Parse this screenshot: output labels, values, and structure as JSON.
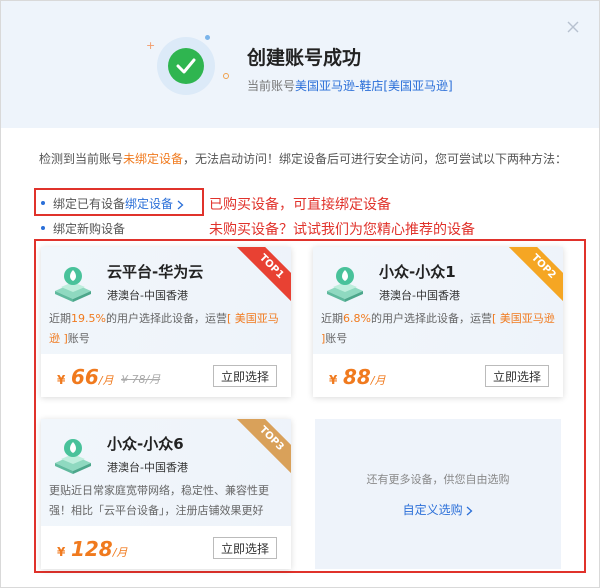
{
  "header": {
    "title": "创建账号成功",
    "subtitle_prefix": "当前账号",
    "account": "美国亚马逊-鞋店[美国亚马逊]",
    "close_icon": "close-icon",
    "success_icon": "check-circle-icon"
  },
  "description": {
    "part1": "检测到当前账号",
    "warn": "未绑定设备",
    "part2": "，无法启动访问！绑定设备后可进行安全访问，您可尝试以下两种方法："
  },
  "options": [
    {
      "text": "绑定已有设备",
      "link": "绑定设备",
      "chevron": "chevron-right-icon"
    },
    {
      "text": "绑定新购设备"
    }
  ],
  "annotations": {
    "bought": "已购买设备，可直接绑定设备",
    "not_bought": "未购买设备？试试我们为您精心推荐的设备"
  },
  "products": [
    {
      "name": "云平台-华为云",
      "region": "港澳台-中国香港",
      "desc_prefix": "近期",
      "percent": "19.5%",
      "desc_mid": "的用户选择此设备，运营",
      "account_hl": "[ 美国亚马逊 ]",
      "desc_suffix": "账号",
      "currency": "¥",
      "price": "66",
      "unit": "/月",
      "old_price": "¥ 78/月",
      "button": "立即选择",
      "ribbon": "TOP1"
    },
    {
      "name": "小众-小众1",
      "region": "港澳台-中国香港",
      "desc_prefix": "近期",
      "percent": "6.8%",
      "desc_mid": "的用户选择此设备，运营",
      "account_hl": "[ 美国亚马逊 ]",
      "desc_suffix": "账号",
      "currency": "¥",
      "price": "88",
      "unit": "/月",
      "button": "立即选择",
      "ribbon": "TOP2"
    },
    {
      "name": "小众-小众6",
      "region": "港澳台-中国香港",
      "desc": "更贴近日常家庭宽带网络，稳定性、兼容性更强！相比「云平台设备」，注册店铺效果更好",
      "currency": "¥",
      "price": "128",
      "unit": "/月",
      "button": "立即选择",
      "ribbon": "TOP3"
    }
  ],
  "more": {
    "text": "还有更多设备，供您自由选购",
    "link": "自定义选购"
  },
  "colors": {
    "accent": "#2b6fd8",
    "warn": "#f07a1e",
    "success": "#2fb550",
    "annotation": "#e0322b"
  }
}
